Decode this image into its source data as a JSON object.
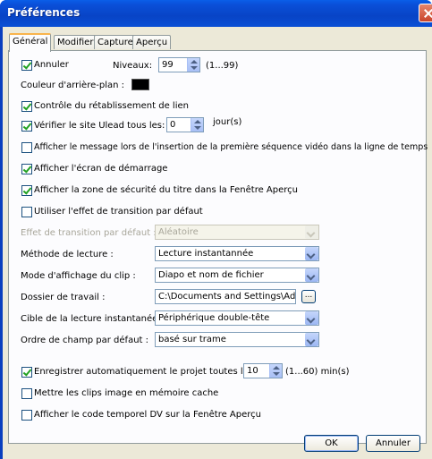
{
  "window": {
    "title": "Préférences"
  },
  "tabs": [
    {
      "label": "Général"
    },
    {
      "label": "Modifier"
    },
    {
      "label": "Capture"
    },
    {
      "label": "Aperçu"
    }
  ],
  "general": {
    "annuler_label": "Annuler",
    "niveaux_label": "Niveaux:",
    "niveaux_value": "99",
    "niveaux_range": "(1...99)",
    "bg_color_label": "Couleur d'arrière-plan :",
    "bg_color": "#000000",
    "link_control_label": "Contrôle du rétablissement de lien",
    "check_site_label": "Vérifier le site Ulead tous les:",
    "check_site_value": "0",
    "check_site_unit": "jour(s)",
    "msg_first_seq_label": "Afficher le message lors de l'insertion de la première séquence vidéo dans la ligne de temps",
    "splash_label": "Afficher l'écran de démarrage",
    "safe_zone_label": "Afficher la zone de sécurité du titre dans la Fenêtre Aperçu",
    "default_transition_label": "Utiliser l'effet de transition par défaut",
    "transition_effect_label": "Effet de transition par défaut :",
    "transition_effect_value": "Aléatoire",
    "playback_method_label": "Méthode de lecture :",
    "playback_method_value": "Lecture instantannée",
    "clip_display_label": "Mode d'affichage du clip :",
    "clip_display_value": "Diapo et nom de fichier",
    "work_folder_label": "Dossier de travail :",
    "work_folder_value": "C:\\Documents and Settings\\Admi",
    "browse_label": "...",
    "instant_target_label": "Cible de la lecture instantanée :",
    "instant_target_value": "Périphérique double-tête",
    "field_order_label": "Ordre de champ par défaut :",
    "field_order_value": "basé sur trame",
    "autosave_label": "Enregistrer automatiquement le projet toutes les :",
    "autosave_value": "10",
    "autosave_range": "(1...60) min(s)",
    "cache_images_label": "Mettre les clips image en mémoire cache",
    "dv_timecode_label": "Afficher le code temporel DV sur la Fenêtre Aperçu"
  },
  "checkboxes": {
    "annuler": true,
    "link_control": true,
    "check_site": true,
    "msg_first_seq": false,
    "splash": true,
    "safe_zone": true,
    "default_transition": false,
    "autosave": true,
    "cache_images": false,
    "dv_timecode": false
  },
  "footer": {
    "ok_label": "OK",
    "cancel_label": "Annuler"
  }
}
